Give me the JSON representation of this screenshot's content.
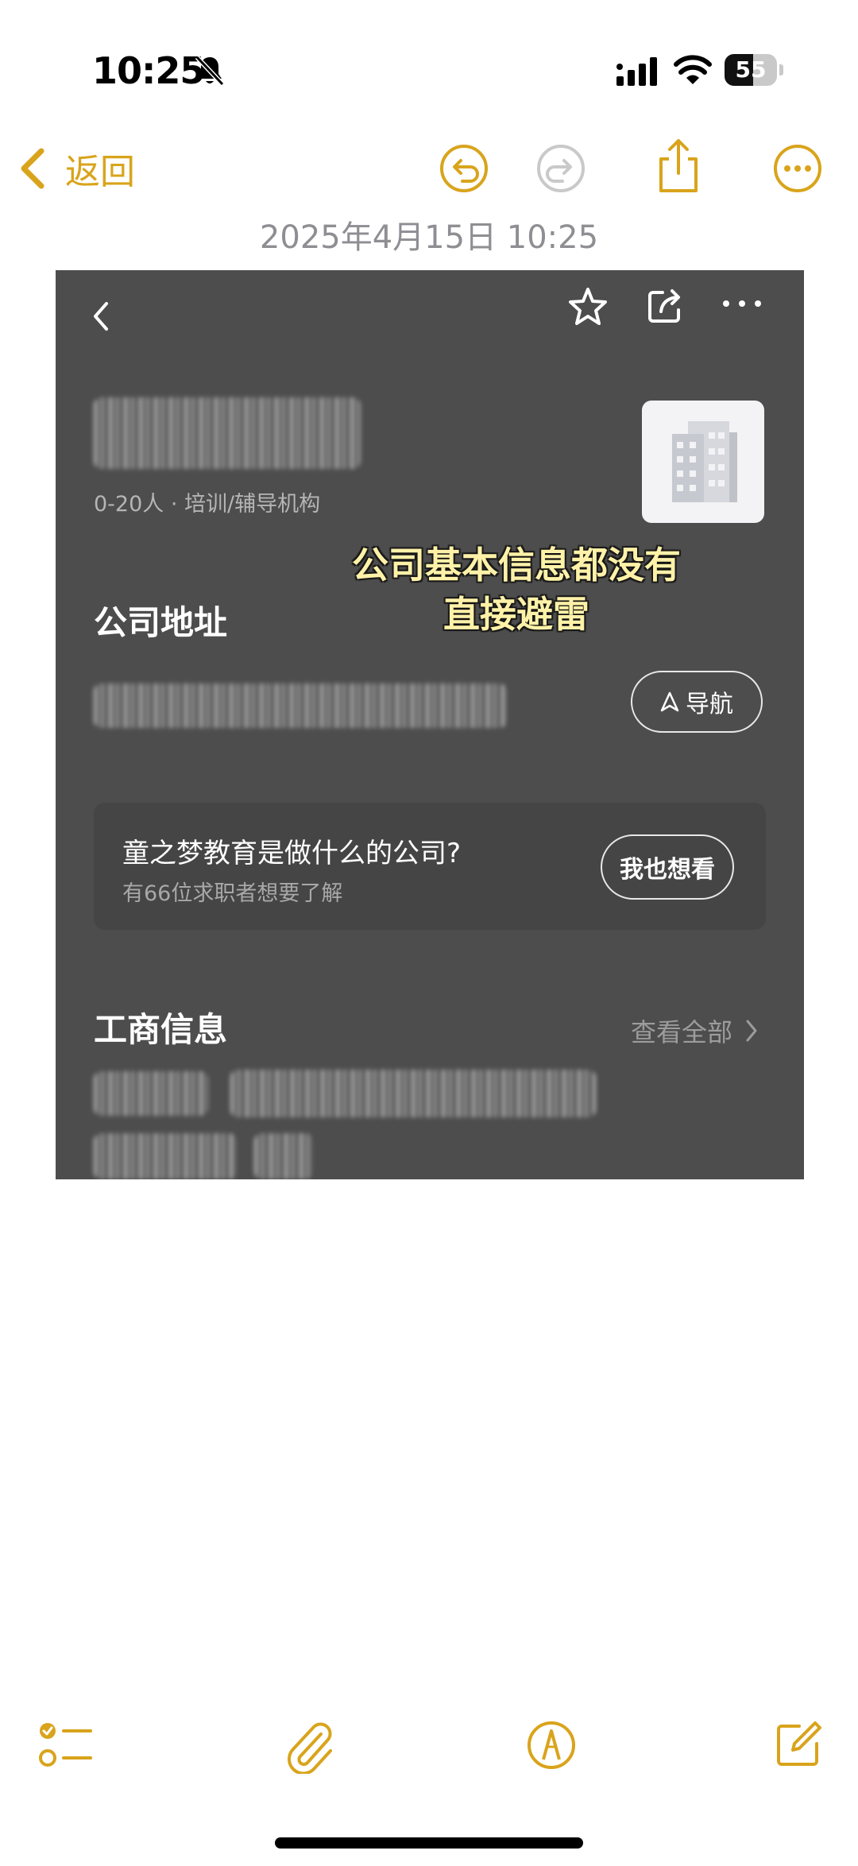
{
  "status_bar": {
    "time": "10:25",
    "battery_level": "55",
    "battery_fraction": 0.55
  },
  "toolbar": {
    "back_label": "返回",
    "icons": [
      "chevron-left-icon",
      "undo-icon",
      "redo-icon",
      "share-icon",
      "more-icon"
    ]
  },
  "note": {
    "timestamp": "2025年4月15日 10:25"
  },
  "screenshot": {
    "company_meta": "0-20人 · 培训/辅导机构",
    "overlay_caption_line1": "公司基本信息都没有",
    "overlay_caption_line2": "直接避雷",
    "address_title": "公司地址",
    "nav_button": "导航",
    "qa_title": "童之梦教育是做什么的公司?",
    "qa_subtitle": "有66位求职者想要了解",
    "qa_button": "我也想看",
    "business_title": "工商信息",
    "view_all": "查看全部"
  },
  "bottom_toolbar": {
    "icons": [
      "checklist-icon",
      "attachment-icon",
      "markup-icon",
      "compose-icon"
    ]
  },
  "colors": {
    "accent": "#d9a41c",
    "screenshot_bg": "#4d4d4d",
    "caption": "#fff2a8"
  }
}
